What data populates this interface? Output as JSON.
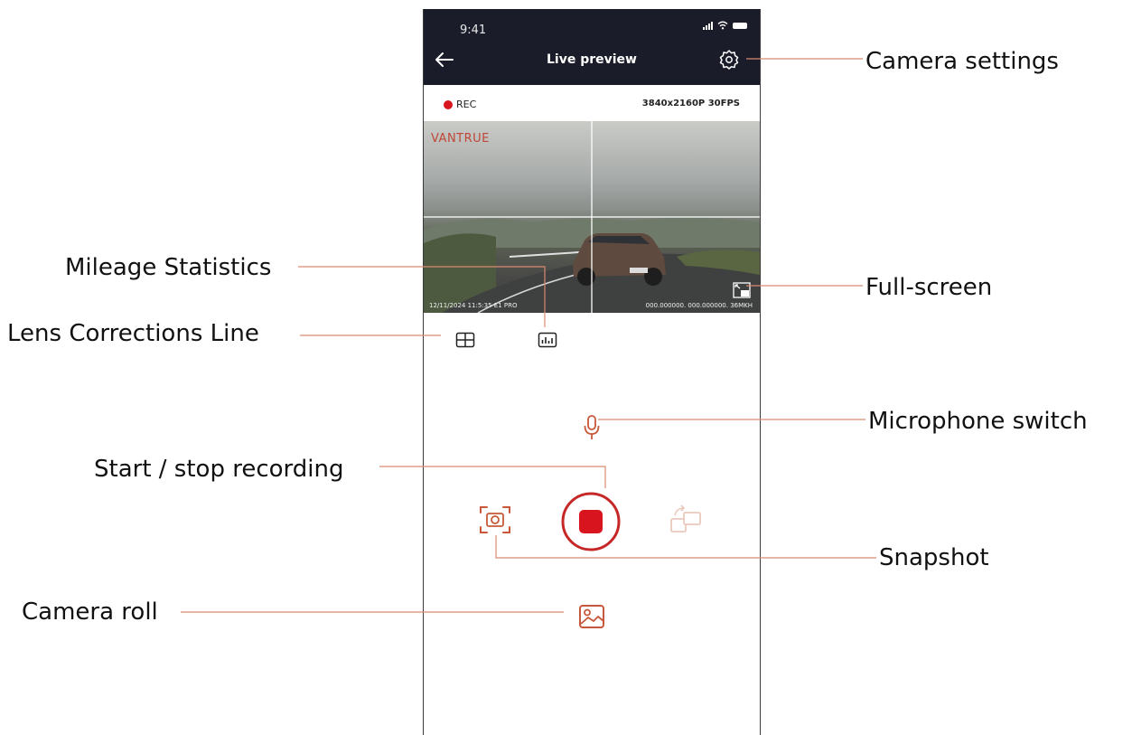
{
  "status_bar": {
    "time": "9:41"
  },
  "header": {
    "title": "Live preview"
  },
  "recording": {
    "rec_label": "REC",
    "resolution": "3840x2160P 30FPS"
  },
  "preview": {
    "watermark": "VANTRUE",
    "overlay_left": "12/11/2024  11:5:35  E1 PRO",
    "overlay_right": "000.000000.   000.000000.   36MKH"
  },
  "icons": {
    "back": "arrow-left-icon",
    "settings": "gear-icon",
    "fullscreen": "fullscreen-icon",
    "lens_grid": "grid-icon",
    "mileage": "bar-chart-icon",
    "microphone": "microphone-icon",
    "snapshot": "camera-icon",
    "record": "record-icon",
    "switch_camera": "switch-camera-icon",
    "camera_roll": "image-icon"
  },
  "callouts": {
    "camera_settings": "Camera settings",
    "mileage_statistics": "Mileage Statistics",
    "full_screen": "Full-screen",
    "lens_corrections": "Lens Corrections Line",
    "microphone_switch": "Microphone switch",
    "start_stop": "Start / stop recording",
    "snapshot": "Snapshot",
    "camera_roll": "Camera roll"
  },
  "colors": {
    "header_bg": "#1b1c2a",
    "accent": "#c8583a",
    "record_red": "#d8141f",
    "leader_line": "#d98a70",
    "disabled": "#e9c9bd"
  }
}
